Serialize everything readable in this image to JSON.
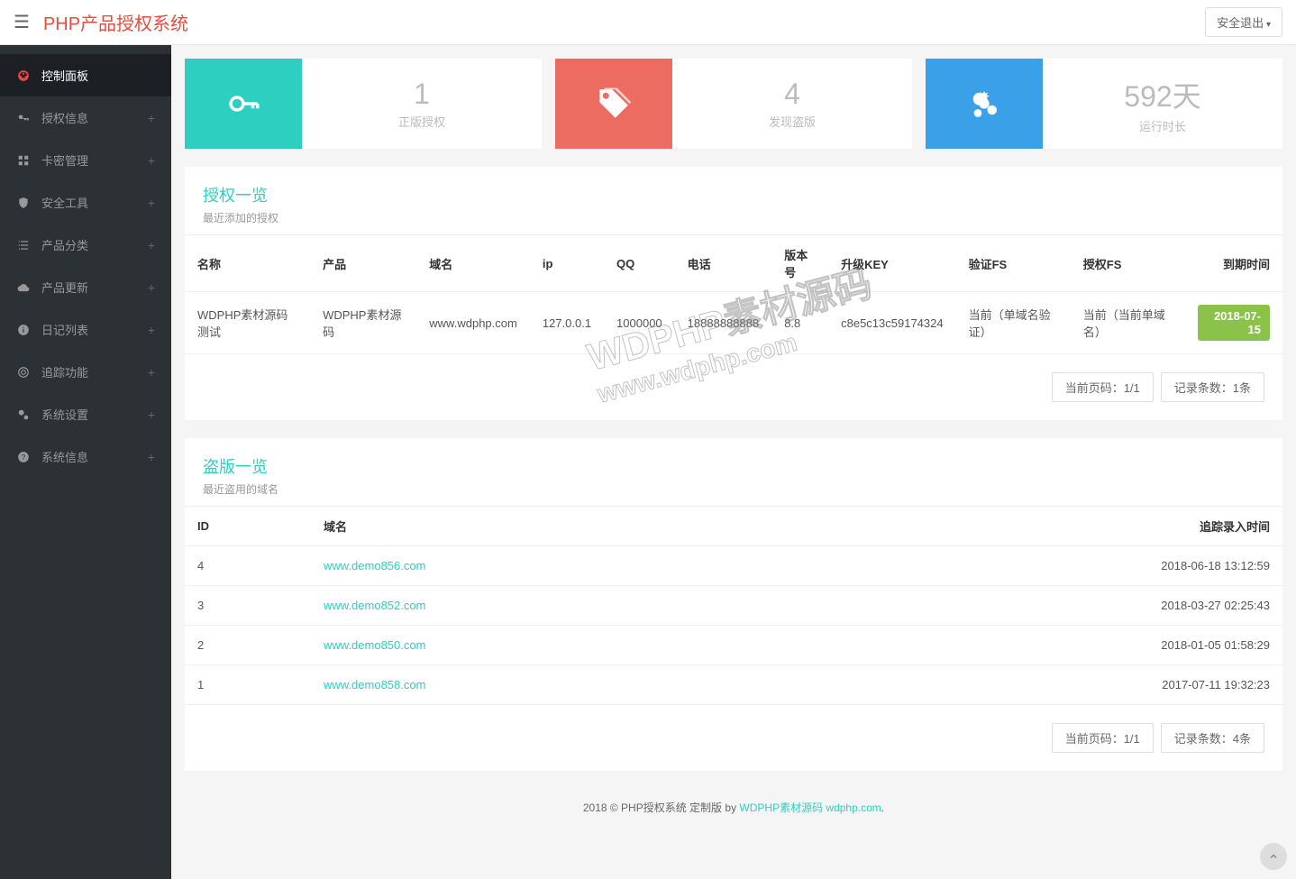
{
  "header": {
    "brand_prefix": "PHP",
    "brand_suffix": "产品授权系统",
    "logout": "安全退出"
  },
  "sidebar": {
    "items": [
      {
        "label": "控制面板",
        "active": true
      },
      {
        "label": "授权信息"
      },
      {
        "label": "卡密管理"
      },
      {
        "label": "安全工具"
      },
      {
        "label": "产品分类"
      },
      {
        "label": "产品更新"
      },
      {
        "label": "日记列表"
      },
      {
        "label": "追踪功能"
      },
      {
        "label": "系统设置"
      },
      {
        "label": "系统信息"
      }
    ]
  },
  "stats": [
    {
      "value": "1",
      "label": "正版授权"
    },
    {
      "value": "4",
      "label": "发现盗版"
    },
    {
      "value": "592天",
      "label": "运行时长"
    }
  ],
  "auth_panel": {
    "title": "授权一览",
    "subtitle": "最近添加的授权",
    "columns": [
      "名称",
      "产品",
      "域名",
      "ip",
      "QQ",
      "电话",
      "版本号",
      "升级KEY",
      "验证FS",
      "授权FS",
      "到期时间"
    ],
    "rows": [
      {
        "name": "WDPHP素材源码测试",
        "product": "WDPHP素材源码",
        "domain": "www.wdphp.com",
        "ip": "127.0.0.1",
        "qq": "1000000",
        "phone": "18888888888",
        "version": "8.8",
        "key": "c8e5c13c59174324",
        "verify_fs": "当前（单域名验证）",
        "auth_fs": "当前（当前单域名）",
        "expire": "2018-07-15"
      }
    ],
    "page_info": "当前页码：1/1",
    "record_info": "记录条数：1条"
  },
  "piracy_panel": {
    "title": "盗版一览",
    "subtitle": "最近盗用的域名",
    "columns": [
      "ID",
      "域名",
      "追踪录入时间"
    ],
    "rows": [
      {
        "id": "4",
        "domain": "www.demo856.com",
        "time": "2018-06-18 13:12:59"
      },
      {
        "id": "3",
        "domain": "www.demo852.com",
        "time": "2018-03-27 02:25:43"
      },
      {
        "id": "2",
        "domain": "www.demo850.com",
        "time": "2018-01-05 01:58:29"
      },
      {
        "id": "1",
        "domain": "www.demo858.com",
        "time": "2017-07-11 19:32:23"
      }
    ],
    "page_info": "当前页码：1/1",
    "record_info": "记录条数：4条"
  },
  "footer": {
    "text_prefix": "2018 © PHP授权系统 定制版 by ",
    "link1": "WDPHP素材源码",
    "link2": "wdphp.com",
    "period": "."
  },
  "watermark": {
    "line1": "WDPHP素材源码",
    "line2": "www.wdphp.com"
  }
}
